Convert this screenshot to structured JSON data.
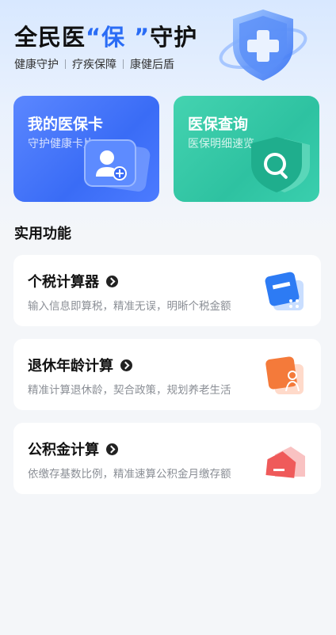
{
  "header": {
    "title_prefix": "全民医",
    "title_highlight": "“保 ”",
    "title_suffix": "守护",
    "subtitle_items": [
      "健康守护",
      "疗疾保障",
      "康健后盾"
    ]
  },
  "cards": [
    {
      "title": "我的医保卡",
      "subtitle": "守护健康卡片",
      "icon": "user-add-icon"
    },
    {
      "title": "医保查询",
      "subtitle": "医保明细速览",
      "icon": "search-shield-icon"
    }
  ],
  "section": {
    "title": "实用功能"
  },
  "features": [
    {
      "title": "个税计算器",
      "desc": "输入信息即算税，精准无误，明晰个税金额",
      "icon": "calculator-icon"
    },
    {
      "title": "退休年龄计算",
      "desc": "精准计算退休龄，契合政策，规划养老生活",
      "icon": "retirement-person-icon"
    },
    {
      "title": "公积金计算",
      "desc": "依缴存基数比例，精准速算公积金月缴存额",
      "icon": "house-icon"
    }
  ],
  "colors": {
    "accent": "#2a6cf5",
    "card_blue": "#3a6cf6",
    "card_green": "#2ec2a1"
  }
}
